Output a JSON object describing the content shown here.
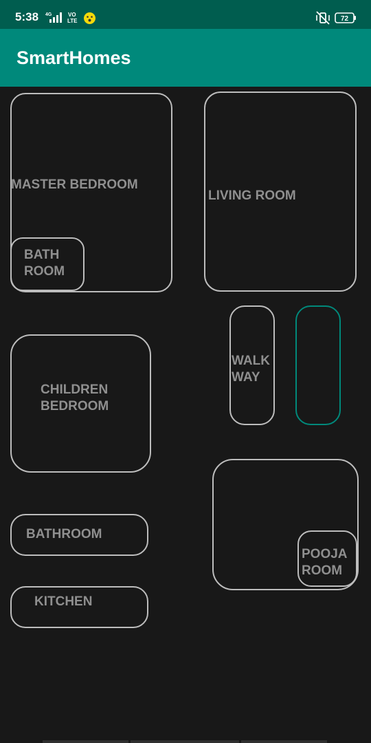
{
  "status_bar": {
    "time": "5:38",
    "network_label": "4G",
    "volte_label": "VoLTE",
    "battery": "72"
  },
  "app_bar": {
    "title": "SmartHomes"
  },
  "rooms": {
    "master_bedroom": "MASTER BEDROOM",
    "bath_room": "BATH\nROOM",
    "living_room": "LIVING ROOM",
    "walk_way": "WALK\nWAY",
    "children_bedroom": "CHILDREN\nBEDROOM",
    "bathroom": "BATHROOM",
    "kitchen": "KITCHEN",
    "pooja_room": "POOJA\nROOM"
  },
  "colors": {
    "status_bar": "#005d4f",
    "app_bar": "#00897b",
    "background": "#181818",
    "room_border": "#bdbdbd",
    "accent_border": "#00897b",
    "room_text": "#8f8f8f"
  }
}
